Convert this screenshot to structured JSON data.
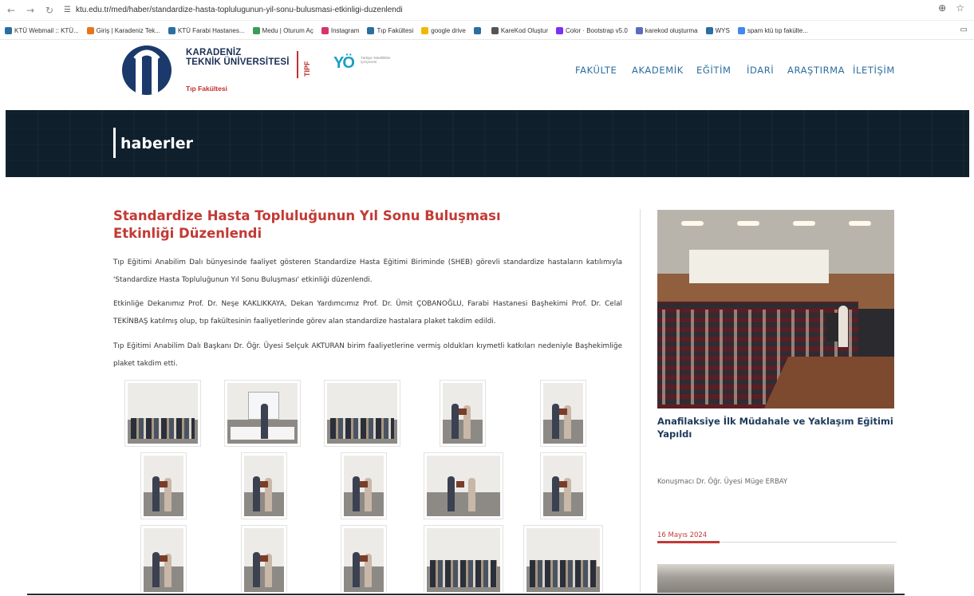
{
  "browser": {
    "url": "ktu.edu.tr/med/haber/standardize-hasta-toplulugunun-yil-sonu-bulusmasi-etkinligi-duzenlendi",
    "bookmarks": [
      {
        "label": "KTÜ Webmail :: KTÜ...",
        "color": "#2b6ea0"
      },
      {
        "label": "Giriş | Karadeniz Tek...",
        "color": "#e6761e"
      },
      {
        "label": "KTÜ Farabi Hastanes...",
        "color": "#2b6ea0"
      },
      {
        "label": "Medu | Oturum Aç",
        "color": "#3d9b5a"
      },
      {
        "label": "Instagram",
        "color": "#d6336c"
      },
      {
        "label": "Tıp Fakültesi",
        "color": "#2b6ea0"
      },
      {
        "label": "google drive",
        "color": "#f2b800"
      },
      {
        "label": "",
        "color": "#2b6ea0"
      },
      {
        "label": "KareKod Oluştur",
        "color": "#555555"
      },
      {
        "label": "Color · Bootstrap v5.0",
        "color": "#7b2ff7"
      },
      {
        "label": "karekod oluşturma",
        "color": "#5c6bc0"
      },
      {
        "label": "WYS",
        "color": "#2b6ea0"
      },
      {
        "label": "spam ktü tıp fakülte...",
        "color": "#4285f4"
      }
    ]
  },
  "header": {
    "logo_line1": "KARADENİZ",
    "logo_line2": "TEKNİK ÜNİVERSİTESİ",
    "logo_sub": "Tıp Fakültesi",
    "tipf": "TIPF",
    "yok_mark": "YÖ",
    "yok_text": "Türkiye Yeterlilikler Çerçevesi",
    "nav": [
      "FAKÜLTE",
      "AKADEMİK",
      "EĞİTİM",
      "İDARİ",
      "ARAŞTIRMA",
      "İLETİŞİM"
    ]
  },
  "banner": {
    "title": "haberler"
  },
  "article": {
    "title": "Standardize Hasta Topluluğunun Yıl Sonu Buluşması Etkinliği Düzenlendi",
    "paragraphs": [
      "Tıp Eğitimi Anabilim Dalı bünyesinde faaliyet gösteren Standardize Hasta Eğitimi Biriminde (SHEB) görevli standardize hastaların katılımıyla 'Standardize Hasta Topluluğunun Yıl Sonu Buluşması' etkinliği düzenlendi.",
      "Etkinliğe Dekanımız Prof. Dr. Neşe KAKLIKKAYA, Dekan Yardımcımız Prof. Dr. Ümit ÇOBANOĞLU, Farabi Hastanesi Başhekimi Prof. Dr. Celal TEKİNBAŞ katılmış olup, tıp fakültesinin faaliyetlerinde görev alan standardize hastalara plaket takdim edildi.",
      "Tıp Eğitimi Anabilim Dalı Başkanı Dr. Öğr. Üyesi Selçuk AKTURAN birim faaliyetlerine vermiş oldukları kıymetli katkıları nedeniyle Başhekimliğe plaket takdim etti."
    ]
  },
  "sidebar": {
    "news_title": "Anafilaksiye İlk Müdahale ve Yaklaşım Eğitimi Yapıldı",
    "news_desc": "Konuşmacı Dr. Öğr. Üyesi Müge ERBAY",
    "date": "16 Mayıs 2024"
  },
  "colors": {
    "accent_red": "#c23a35",
    "nav_blue": "#2b6ea0",
    "banner_dark": "#0f1f2c"
  }
}
